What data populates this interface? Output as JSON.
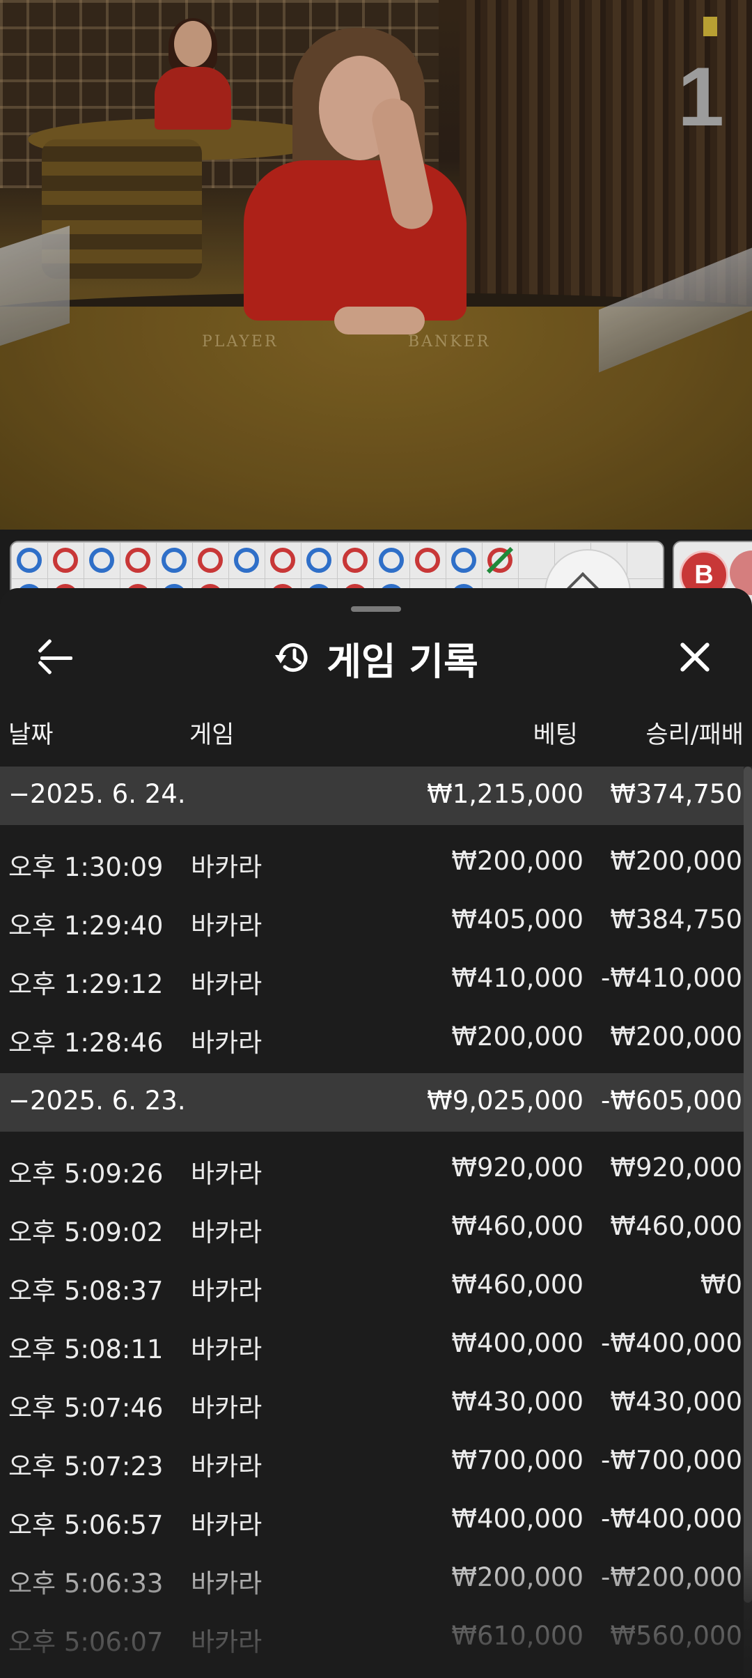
{
  "video": {
    "round_number": "1",
    "table_labels": [
      "PLAYER",
      "BANKER"
    ]
  },
  "scoreboard": {
    "top_row": [
      "b",
      "r",
      "b",
      "r",
      "b",
      "r",
      "b",
      "r",
      "b",
      "r",
      "b",
      "r",
      "b",
      "r-tie"
    ],
    "side_badge": "B"
  },
  "sheet": {
    "title": "게임 기록",
    "columns": {
      "date": "날짜",
      "game": "게임",
      "bet": "베팅",
      "win_loss": "승리/패배"
    },
    "groups": [
      {
        "date": "−2025. 6. 24.",
        "bet": "₩1,215,000",
        "win_loss": "₩374,750",
        "rows": [
          {
            "time": "오후 1:30:09",
            "game": "바카라",
            "bet": "₩200,000",
            "win_loss": "₩200,000"
          },
          {
            "time": "오후 1:29:40",
            "game": "바카라",
            "bet": "₩405,000",
            "win_loss": "₩384,750"
          },
          {
            "time": "오후 1:29:12",
            "game": "바카라",
            "bet": "₩410,000",
            "win_loss": "-₩410,000"
          },
          {
            "time": "오후 1:28:46",
            "game": "바카라",
            "bet": "₩200,000",
            "win_loss": "₩200,000"
          }
        ]
      },
      {
        "date": "−2025. 6. 23.",
        "bet": "₩9,025,000",
        "win_loss": "-₩605,000",
        "rows": [
          {
            "time": "오후 5:09:26",
            "game": "바카라",
            "bet": "₩920,000",
            "win_loss": "₩920,000"
          },
          {
            "time": "오후 5:09:02",
            "game": "바카라",
            "bet": "₩460,000",
            "win_loss": "₩460,000"
          },
          {
            "time": "오후 5:08:37",
            "game": "바카라",
            "bet": "₩460,000",
            "win_loss": "₩0"
          },
          {
            "time": "오후 5:08:11",
            "game": "바카라",
            "bet": "₩400,000",
            "win_loss": "-₩400,000"
          },
          {
            "time": "오후 5:07:46",
            "game": "바카라",
            "bet": "₩430,000",
            "win_loss": "₩430,000"
          },
          {
            "time": "오후 5:07:23",
            "game": "바카라",
            "bet": "₩700,000",
            "win_loss": "-₩700,000"
          },
          {
            "time": "오후 5:06:57",
            "game": "바카라",
            "bet": "₩400,000",
            "win_loss": "-₩400,000"
          },
          {
            "time": "오후 5:06:33",
            "game": "바카라",
            "bet": "₩200,000",
            "win_loss": "-₩200,000"
          },
          {
            "time": "오후 5:06:07",
            "game": "바카라",
            "bet": "₩610,000",
            "win_loss": "₩560,000"
          }
        ]
      }
    ]
  }
}
